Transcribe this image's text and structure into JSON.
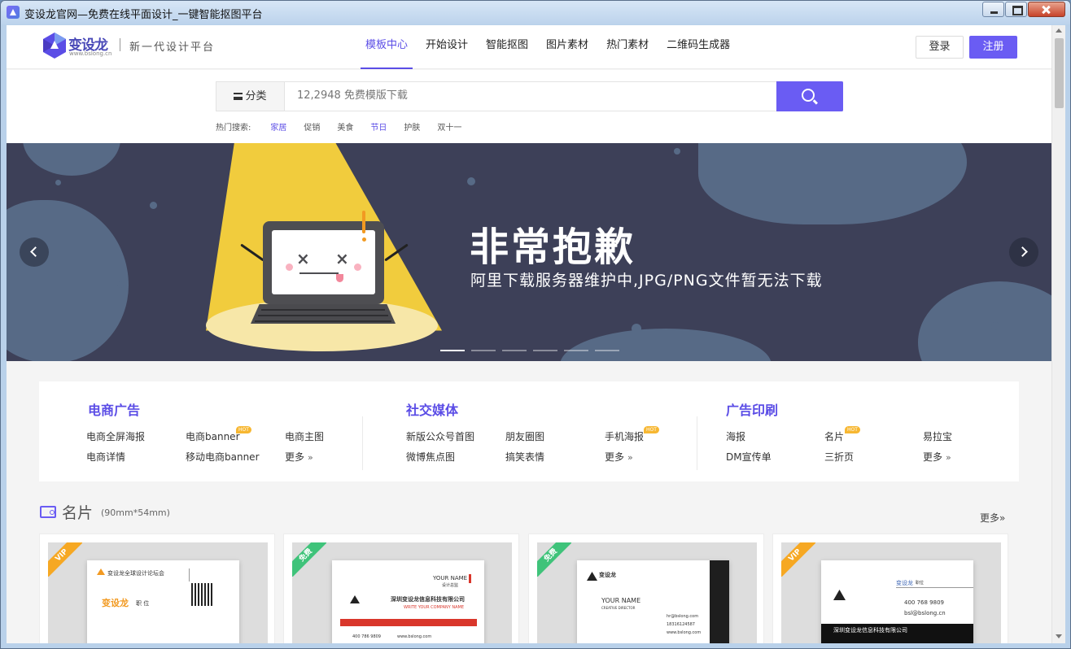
{
  "window": {
    "title": "变设龙官网—免费在线平面设计_一键智能抠图平台"
  },
  "header": {
    "logo_text": "变设龙",
    "logo_sub": "www.bslong.cn",
    "slogan": "新一代设计平台",
    "nav": [
      "模板中心",
      "开始设计",
      "智能抠图",
      "图片素材",
      "热门素材",
      "二维码生成器"
    ],
    "login": "登录",
    "register": "注册"
  },
  "search": {
    "category_label": "分类",
    "placeholder": "12,2948 免费模版下载",
    "hot_label": "热门搜索:",
    "hot_terms": [
      "家居",
      "促销",
      "美食",
      "节日",
      "护肤",
      "双十一"
    ]
  },
  "banner": {
    "title": "非常抱歉",
    "subtitle": "阿里下载服务器维护中,JPG/PNG文件暂无法下载",
    "slide_count": 6,
    "active_slide": 1
  },
  "categories": [
    {
      "title": "电商广告",
      "links": [
        "电商全屏海报",
        "电商banner",
        "电商主图",
        "电商详情",
        "移动电商banner",
        "更多"
      ],
      "hot": "HOT"
    },
    {
      "title": "社交媒体",
      "links": [
        "新版公众号首图",
        "朋友圈图",
        "手机海报",
        "微博焦点图",
        "搞笑表情",
        "更多"
      ],
      "hot": "HOT"
    },
    {
      "title": "广告印刷",
      "links": [
        "海报",
        "名片",
        "易拉宝",
        "DM宣传单",
        "三折页",
        "更多"
      ],
      "hot": "HOT"
    }
  ],
  "section": {
    "title": "名片",
    "subtitle": "(90mm*54mm)",
    "more": "更多"
  },
  "cards": [
    {
      "badge": "VIP",
      "texts": [
        "变设龙全球设计论坛会",
        "变设龙",
        "职 位"
      ]
    },
    {
      "badge": "免费",
      "texts": [
        "YOUR NAME",
        "设计总监",
        "深圳变设龙信息科技有限公司",
        "WRITE YOUR COMPANY NAME",
        "400 786 9809",
        "www.bslong.com"
      ]
    },
    {
      "badge": "免费",
      "texts": [
        "变设龙",
        "YOUR NAME",
        "CREATIVE DIRECTOR",
        "hr@bslong.com",
        "18316124587",
        "www.bslong.com"
      ]
    },
    {
      "badge": "VIP",
      "texts": [
        "变设龙",
        "职位",
        "400 768 9809",
        "bsl@bslong.cn",
        "深圳变设龙信息科技有限公司"
      ]
    }
  ]
}
